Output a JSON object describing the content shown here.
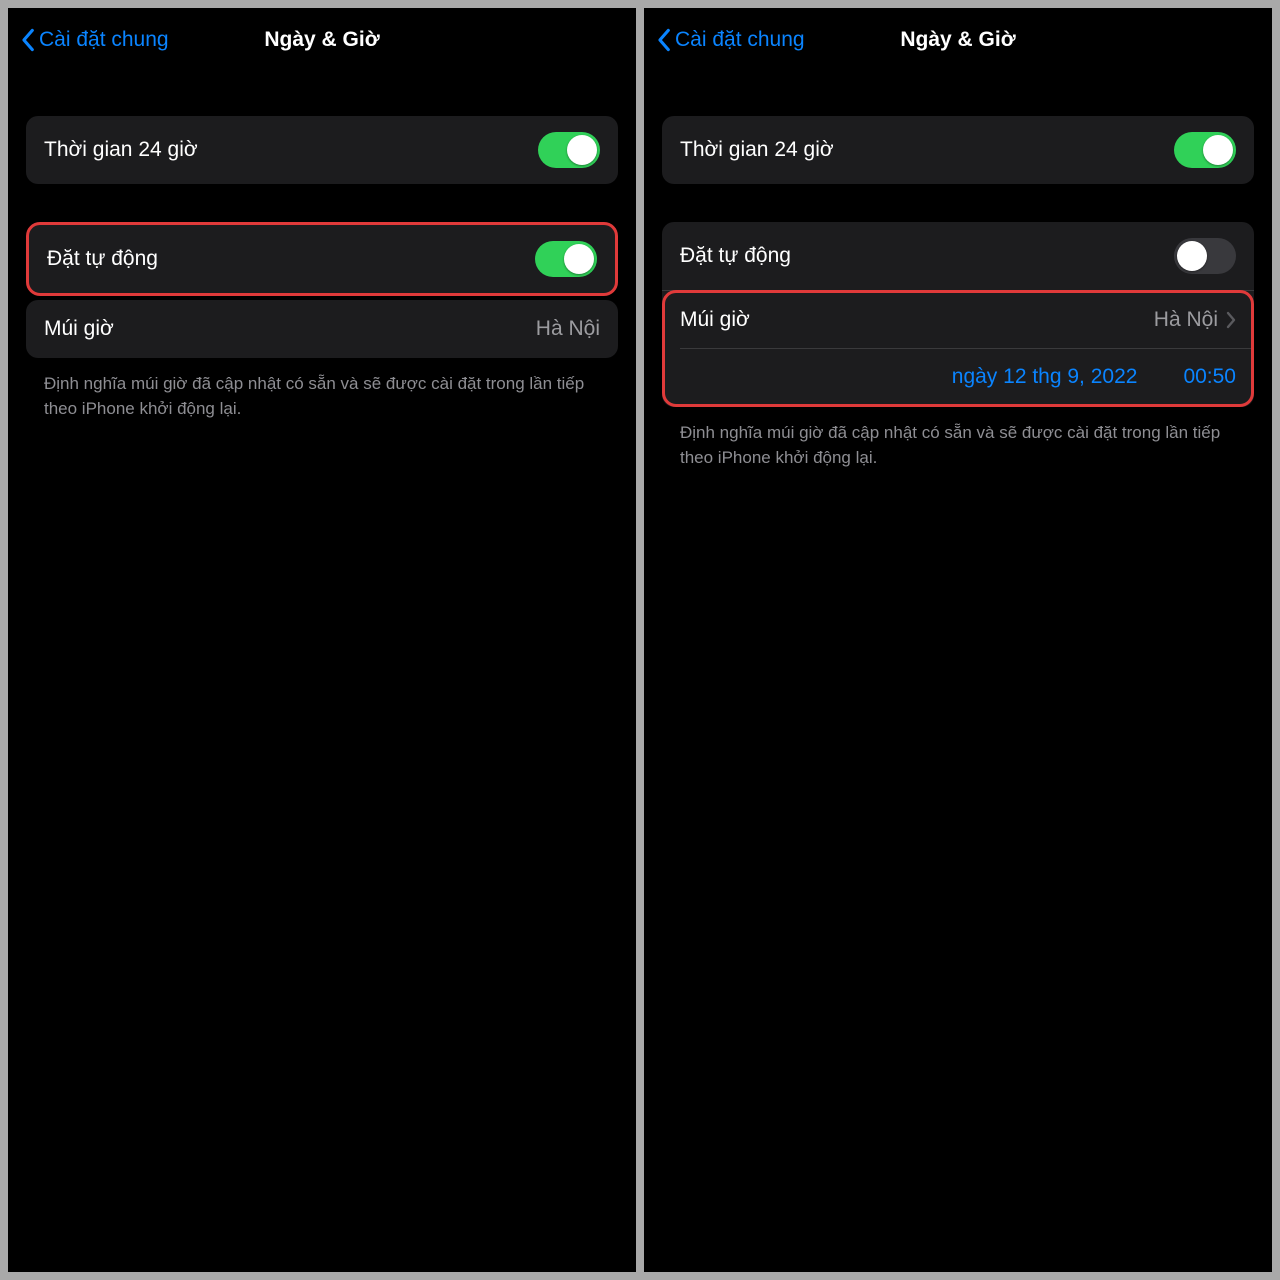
{
  "left": {
    "back_label": "Cài đặt chung",
    "title": "Ngày & Giờ",
    "row24_label": "Thời gian 24 giờ",
    "row24_on": true,
    "auto_label": "Đặt tự động",
    "auto_on": true,
    "tz_label": "Múi giờ",
    "tz_value": "Hà Nội",
    "footer": "Định nghĩa múi giờ đã cập nhật có sẵn và sẽ được cài đặt trong lần tiếp theo iPhone khởi động lại."
  },
  "right": {
    "back_label": "Cài đặt chung",
    "title": "Ngày & Giờ",
    "row24_label": "Thời gian 24 giờ",
    "row24_on": true,
    "auto_label": "Đặt tự động",
    "auto_on": false,
    "tz_label": "Múi giờ",
    "tz_value": "Hà Nội",
    "date_text": "ngày 12 thg 9, 2022",
    "time_text": "00:50",
    "footer": "Định nghĩa múi giờ đã cập nhật có sẵn và sẽ được cài đặt trong lần tiếp theo iPhone khởi động lại."
  }
}
